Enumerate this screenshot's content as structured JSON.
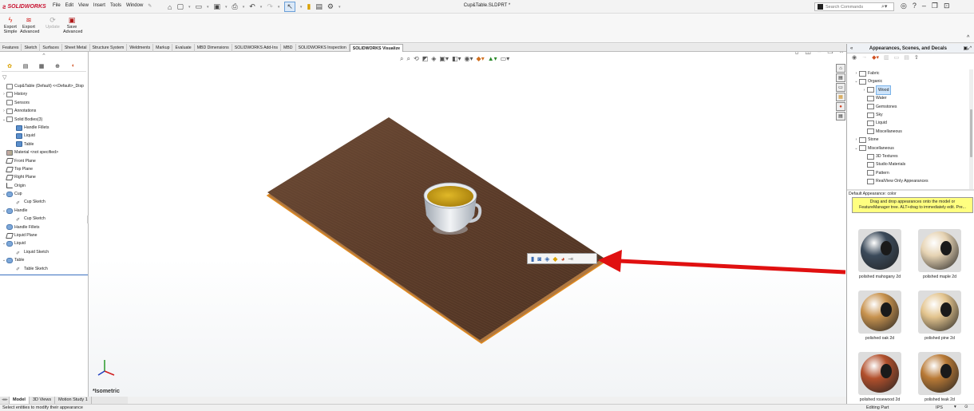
{
  "app": {
    "logo": "SOLIDWORKS",
    "menus": [
      "File",
      "Edit",
      "View",
      "Insert",
      "Tools",
      "Window"
    ],
    "doc_title": "Cup&Table.SLDPRT *",
    "search_placeholder": "Search Commands"
  },
  "command_manager": {
    "buttons": [
      {
        "label1": "Export",
        "label2": "Simple",
        "icon": "lightning-icon"
      },
      {
        "label1": "Export",
        "label2": "Advanced",
        "icon": "export-advanced-icon"
      },
      {
        "label1": "Update",
        "label2": "",
        "icon": "update-icon",
        "disabled": true
      },
      {
        "label1": "Save",
        "label2": "Advanced",
        "icon": "save-advanced-icon"
      }
    ]
  },
  "tabs": [
    "Features",
    "Sketch",
    "Surfaces",
    "Sheet Metal",
    "Structure System",
    "Weldments",
    "Markup",
    "Evaluate",
    "MBD Dimensions",
    "SOLIDWORKS Add-Ins",
    "MBD",
    "SOLIDWORKS Inspection",
    "SOLIDWORKS Visualize"
  ],
  "active_tab": "SOLIDWORKS Visualize",
  "feature_tree": {
    "items": [
      {
        "label": "Cup&Table (Default) <<Default>_Disp",
        "icon": "part",
        "arrow": "",
        "indent": 0
      },
      {
        "label": "History",
        "icon": "folder",
        "arrow": "›",
        "indent": 0
      },
      {
        "label": "Sensors",
        "icon": "folder",
        "arrow": "",
        "indent": 0
      },
      {
        "label": "Annotations",
        "icon": "folder",
        "arrow": "›",
        "indent": 0
      },
      {
        "label": "Solid Bodies(3)",
        "icon": "folder",
        "arrow": "⌄",
        "indent": 0
      },
      {
        "label": "Handle Fillets",
        "icon": "body",
        "arrow": "",
        "indent": 1
      },
      {
        "label": "Liquid",
        "icon": "body",
        "arrow": "",
        "indent": 1
      },
      {
        "label": "Table",
        "icon": "body",
        "arrow": "",
        "indent": 1
      },
      {
        "label": "Material <not specified>",
        "icon": "mat",
        "arrow": "",
        "indent": 0
      },
      {
        "label": "Front Plane",
        "icon": "plane",
        "arrow": "",
        "indent": 0
      },
      {
        "label": "Top Plane",
        "icon": "plane",
        "arrow": "",
        "indent": 0
      },
      {
        "label": "Right Plane",
        "icon": "plane",
        "arrow": "",
        "indent": 0
      },
      {
        "label": "Origin",
        "icon": "origin",
        "arrow": "",
        "indent": 0
      },
      {
        "label": "Cup",
        "icon": "feat",
        "arrow": "⌄",
        "indent": 0
      },
      {
        "label": "Cup Sketch",
        "icon": "sk",
        "arrow": "",
        "indent": 1
      },
      {
        "label": "Handle",
        "icon": "feat",
        "arrow": "⌄",
        "indent": 0
      },
      {
        "label": "Cup Sketch",
        "icon": "sk",
        "arrow": "",
        "indent": 1
      },
      {
        "label": "Handle Fillets",
        "icon": "feat",
        "arrow": "",
        "indent": 0
      },
      {
        "label": "Liquid Plane",
        "icon": "plane",
        "arrow": "",
        "indent": 0
      },
      {
        "label": "Liquid",
        "icon": "feat",
        "arrow": "⌄",
        "indent": 0
      },
      {
        "label": "Liquid Sketch",
        "icon": "sk",
        "arrow": "",
        "indent": 1
      },
      {
        "label": "Table",
        "icon": "feat",
        "arrow": "⌄",
        "indent": 0
      },
      {
        "label": "Table Sketch",
        "icon": "sk",
        "arrow": "",
        "indent": 1
      }
    ]
  },
  "graphics": {
    "view_label": "*Isometric",
    "mini_toolbar_icons": [
      "body-icon",
      "face-icon",
      "feature-icon",
      "part-appearance-icon",
      "appearance-icon",
      "pin-icon"
    ]
  },
  "model_tabs": [
    "Model",
    "3D Views",
    "Motion Study 1"
  ],
  "status": {
    "left": "Select entities to modify their appearance",
    "mode": "Editing Part",
    "units": "IPS"
  },
  "task_pane": {
    "title": "Appearances, Scenes, and Decals",
    "tree": [
      {
        "label": "Fabric",
        "arrow": "›",
        "indent": 0,
        "selected": false
      },
      {
        "label": "Organic",
        "arrow": "⌄",
        "indent": 0,
        "selected": false
      },
      {
        "label": "Wood",
        "arrow": "›",
        "indent": 1,
        "selected": true
      },
      {
        "label": "Water",
        "arrow": "",
        "indent": 1,
        "selected": false
      },
      {
        "label": "Gemstones",
        "arrow": "",
        "indent": 1,
        "selected": false
      },
      {
        "label": "Sky",
        "arrow": "",
        "indent": 1,
        "selected": false
      },
      {
        "label": "Liquid",
        "arrow": "",
        "indent": 1,
        "selected": false
      },
      {
        "label": "Miscellaneous",
        "arrow": "",
        "indent": 1,
        "selected": false
      },
      {
        "label": "Stone",
        "arrow": "›",
        "indent": 0,
        "selected": false
      },
      {
        "label": "Miscellaneous",
        "arrow": "⌄",
        "indent": 0,
        "selected": false
      },
      {
        "label": "3D Textures",
        "arrow": "",
        "indent": 1,
        "selected": false
      },
      {
        "label": "Studio Materials",
        "arrow": "",
        "indent": 1,
        "selected": false
      },
      {
        "label": "Pattern",
        "arrow": "",
        "indent": 1,
        "selected": false
      },
      {
        "label": "RealView Only Appearances",
        "arrow": "",
        "indent": 1,
        "selected": false
      }
    ],
    "default_appearance": "Default Appearance: color",
    "tooltip": "Drag and drop appearances onto the model or FeatureManager tree. ALT+drag to immediately edit. Pre...",
    "swatches": [
      {
        "label": "polished mahogany 2d",
        "color": "#3b4a5a"
      },
      {
        "label": "polished maple 2d",
        "color": "#e6d3b3"
      },
      {
        "label": "polished oak 2d",
        "color": "#c8934f"
      },
      {
        "label": "polished pine 2d",
        "color": "#e3c48e"
      },
      {
        "label": "polished rosewood 2d",
        "color": "#b2502c"
      },
      {
        "label": "polished teak 2d",
        "color": "#b97a36"
      }
    ]
  },
  "colors": {
    "accent_red": "#e01010",
    "table_wood": "#5a3a28",
    "table_edge": "#e08a20",
    "liquid": "#c8a018"
  }
}
